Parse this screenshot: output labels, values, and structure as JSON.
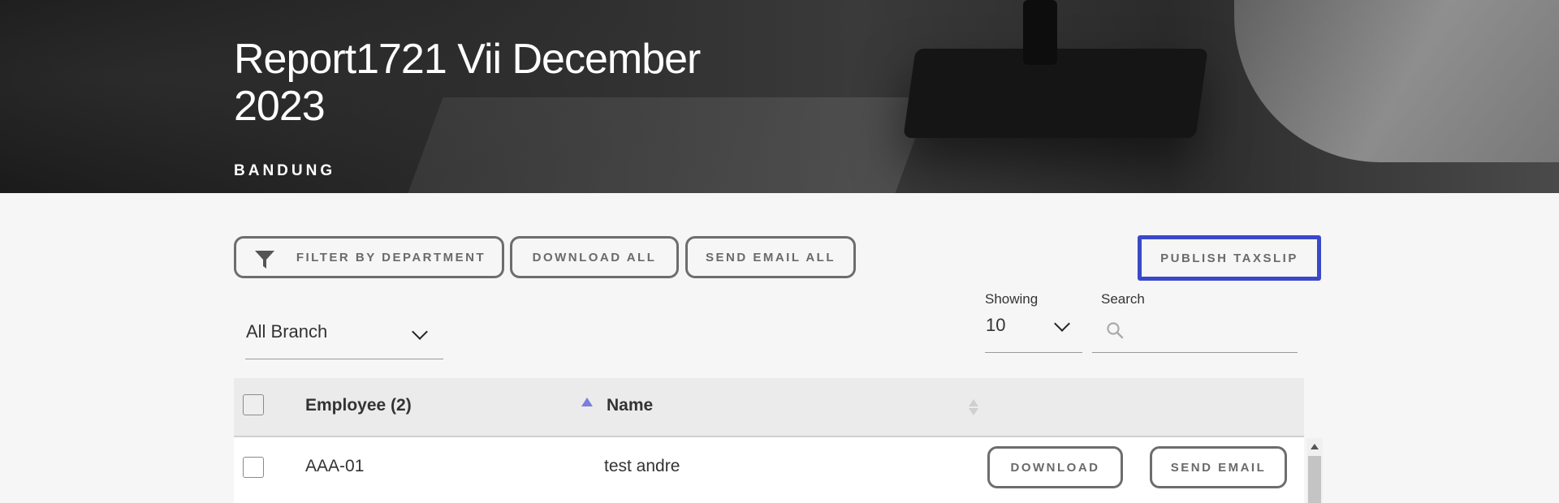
{
  "header": {
    "title": "Report1721 Vii December 2023",
    "subtitle": "BANDUNG"
  },
  "toolbar": {
    "filter_label": "FILTER BY DEPARTMENT",
    "download_all_label": "DOWNLOAD ALL",
    "send_email_all_label": "SEND EMAIL ALL",
    "publish_label": "PUBLISH TAXSLIP",
    "publish_border_color": "#3b48c9"
  },
  "filters": {
    "branch_value": "All Branch",
    "showing_label": "Showing",
    "showing_value": "10",
    "search_label": "Search",
    "search_value": ""
  },
  "table": {
    "columns": [
      "Employee (2)",
      "Name"
    ],
    "sort": {
      "employee": "ascending",
      "name": "unsorted",
      "active_color": "#7a7fdc"
    },
    "rows": [
      {
        "employee": "AAA-01",
        "name": "test andre",
        "download_label": "DOWNLOAD",
        "send_email_label": "SEND EMAIL"
      }
    ]
  }
}
